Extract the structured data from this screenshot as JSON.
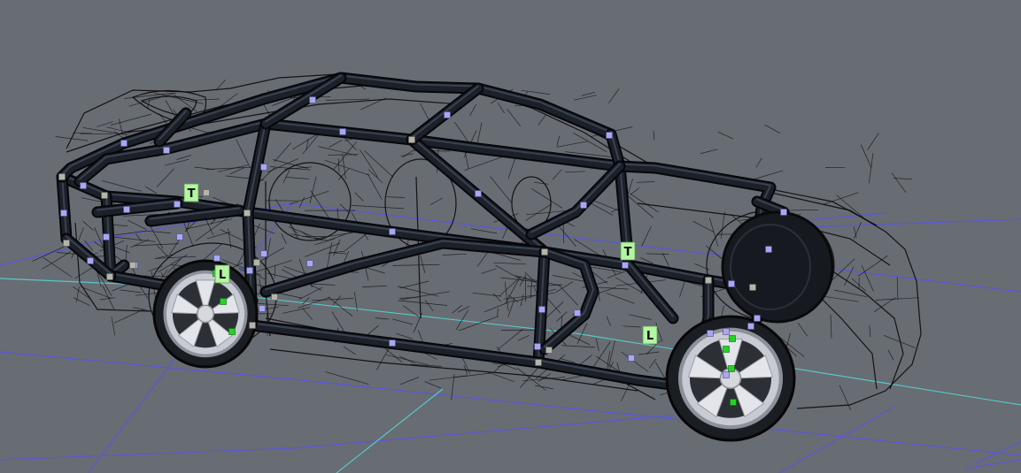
{
  "scene": {
    "background": "#686c73",
    "grid_color": "#5858d8",
    "grid_axis_color": "#58c8c8",
    "wire_color": "#0b0b0b",
    "tube_color": "#1b2029",
    "wheel_color": "#c8cbd3",
    "brake_color": "#c66a22"
  },
  "node_colors": {
    "normal": "#a8a8f2",
    "anchor": "#b4b4aa",
    "wheel": "#25d225"
  },
  "tags": {
    "label_color": "#b3f5a3",
    "items": [
      "T",
      "T",
      "L",
      "L"
    ]
  }
}
